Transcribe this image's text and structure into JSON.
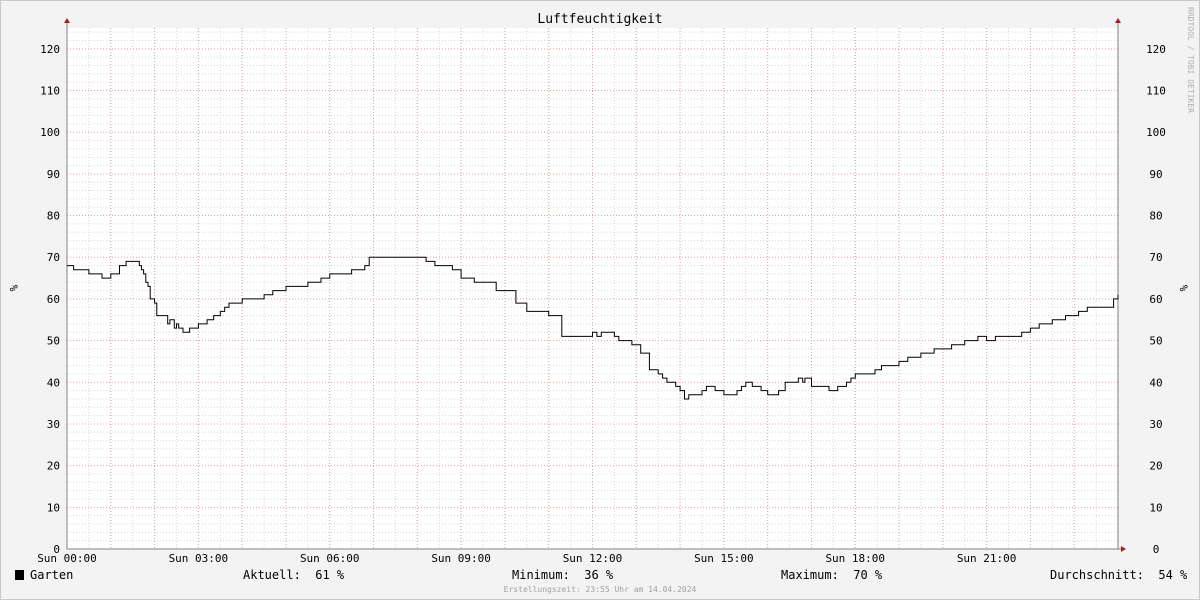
{
  "chart_data": {
    "type": "line",
    "title": "Luftfeuchtigkeit",
    "ylabel": "%",
    "ylim": [
      0,
      125
    ],
    "yticks": [
      0,
      10,
      20,
      30,
      40,
      50,
      60,
      70,
      80,
      90,
      100,
      110,
      120
    ],
    "xlim": [
      0,
      24
    ],
    "xticks": [
      {
        "h": 0,
        "label": "Sun 00:00"
      },
      {
        "h": 3,
        "label": "Sun 03:00"
      },
      {
        "h": 6,
        "label": "Sun 06:00"
      },
      {
        "h": 9,
        "label": "Sun 09:00"
      },
      {
        "h": 12,
        "label": "Sun 12:00"
      },
      {
        "h": 15,
        "label": "Sun 15:00"
      },
      {
        "h": 18,
        "label": "Sun 18:00"
      },
      {
        "h": 21,
        "label": "Sun 21:00"
      }
    ],
    "grid": true,
    "series": [
      {
        "name": "Garten",
        "color": "#000000",
        "x": [
          0,
          0.15,
          0.5,
          0.8,
          1.0,
          1.2,
          1.35,
          1.65,
          1.7,
          1.75,
          1.8,
          1.85,
          1.9,
          2.0,
          2.05,
          2.3,
          2.35,
          2.45,
          2.5,
          2.55,
          2.65,
          2.8,
          3.0,
          3.05,
          3.2,
          3.35,
          3.5,
          3.6,
          3.7,
          4.0,
          4.5,
          4.7,
          5.0,
          5.3,
          5.5,
          5.8,
          6.0,
          6.5,
          6.8,
          6.9,
          7.8,
          8.2,
          8.3,
          8.4,
          8.6,
          8.8,
          9.0,
          9.3,
          9.8,
          10.0,
          10.25,
          10.5,
          11.0,
          11.3,
          11.4,
          11.6,
          11.8,
          12.0,
          12.05,
          12.1,
          12.2,
          12.3,
          12.5,
          12.6,
          12.9,
          13.1,
          13.3,
          13.5,
          13.6,
          13.7,
          13.9,
          14.0,
          14.1,
          14.2,
          14.5,
          14.6,
          14.8,
          15.0,
          15.3,
          15.4,
          15.5,
          15.65,
          15.85,
          16.0,
          16.25,
          16.4,
          16.7,
          16.8,
          16.85,
          17.0,
          17.2,
          17.4,
          17.6,
          17.8,
          17.9,
          18.0,
          18.2,
          18.45,
          18.6,
          19.0,
          19.2,
          19.5,
          19.8,
          20.2,
          20.5,
          20.8,
          21.0,
          21.2,
          21.3,
          21.8,
          22.0,
          22.2,
          22.5,
          22.8,
          23.1,
          23.3,
          23.9,
          24.0
        ],
        "values": [
          68,
          67,
          66,
          65,
          66,
          68,
          69,
          68,
          67,
          66,
          64,
          63,
          60,
          59,
          56,
          54,
          55,
          53,
          54,
          53,
          52,
          53,
          54,
          54,
          55,
          56,
          57,
          58,
          59,
          60,
          61,
          62,
          63,
          63,
          64,
          65,
          66,
          67,
          68,
          70,
          70,
          69,
          69,
          68,
          68,
          67,
          65,
          64,
          62,
          62,
          59,
          57,
          56,
          51,
          51,
          51,
          51,
          52,
          52,
          51,
          52,
          52,
          51,
          50,
          49,
          47,
          43,
          42,
          41,
          40,
          39,
          38,
          36,
          37,
          38,
          39,
          38,
          37,
          38,
          39,
          40,
          39,
          38,
          37,
          38,
          40,
          41,
          40,
          41,
          39,
          39,
          38,
          39,
          40,
          41,
          42,
          42,
          43,
          44,
          45,
          46,
          47,
          48,
          49,
          50,
          51,
          50,
          51,
          51,
          52,
          53,
          54,
          55,
          56,
          57,
          58,
          60,
          61
        ]
      }
    ]
  },
  "watermark": "RRDTOOL / TOBI OETIKER",
  "legend": {
    "series_label": "Garten",
    "color": "#000000",
    "aktuell": "Aktuell:  61 %",
    "minimum": "Minimum:  36 %",
    "maximum": "Maximum:  70 %",
    "durchschnitt": "Durchschnitt:  54 %"
  },
  "footer": "Erstellungszeit: 23:55 Uhr am 14.04.2024",
  "colors": {
    "background": "#f3f3f3",
    "plot": "#ffffff",
    "minor_grid": "#d8d8d8",
    "major_grid": "#e8a0a0",
    "axis": "#808080",
    "arrow": "#a02020",
    "line": "#000000"
  }
}
